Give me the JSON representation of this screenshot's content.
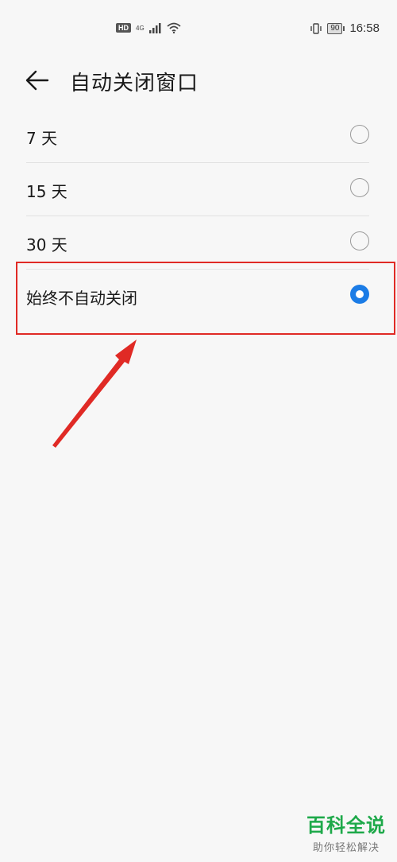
{
  "status_bar": {
    "hd_badge": "HD",
    "network_type": "4G",
    "battery_level": "90",
    "time": "16:58",
    "icons": [
      "hd-icon",
      "signal-icon",
      "wifi-icon",
      "vibrate-icon",
      "battery-icon"
    ]
  },
  "header": {
    "back_icon": "arrow-left-icon",
    "title": "自动关闭窗口"
  },
  "options": [
    {
      "label": "7 天",
      "selected": false
    },
    {
      "label": "15 天",
      "selected": false
    },
    {
      "label": "30 天",
      "selected": false
    },
    {
      "label": "始终不自动关闭",
      "selected": true
    }
  ],
  "colors": {
    "accent": "#1b7ce6",
    "annotation": "#e02a25",
    "watermark": "#1ea94a"
  },
  "watermark": {
    "brand": "百科全说",
    "tagline": "助你轻松解决"
  }
}
